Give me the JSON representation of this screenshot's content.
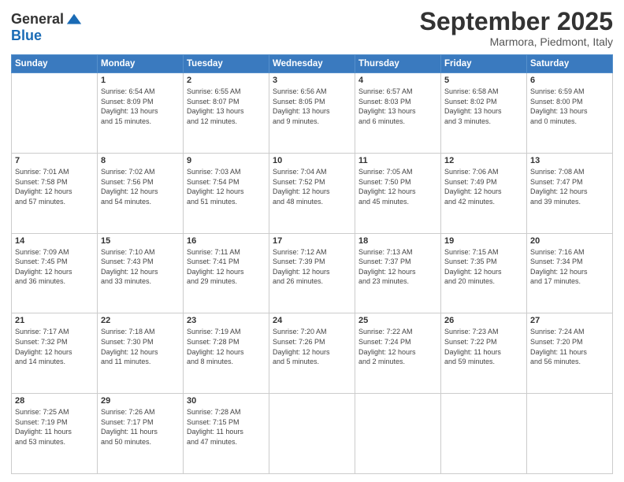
{
  "header": {
    "logo_line1": "General",
    "logo_line2": "Blue",
    "month": "September 2025",
    "location": "Marmora, Piedmont, Italy"
  },
  "weekdays": [
    "Sunday",
    "Monday",
    "Tuesday",
    "Wednesday",
    "Thursday",
    "Friday",
    "Saturday"
  ],
  "weeks": [
    [
      {
        "day": "",
        "text": ""
      },
      {
        "day": "1",
        "text": "Sunrise: 6:54 AM\nSunset: 8:09 PM\nDaylight: 13 hours\nand 15 minutes."
      },
      {
        "day": "2",
        "text": "Sunrise: 6:55 AM\nSunset: 8:07 PM\nDaylight: 13 hours\nand 12 minutes."
      },
      {
        "day": "3",
        "text": "Sunrise: 6:56 AM\nSunset: 8:05 PM\nDaylight: 13 hours\nand 9 minutes."
      },
      {
        "day": "4",
        "text": "Sunrise: 6:57 AM\nSunset: 8:03 PM\nDaylight: 13 hours\nand 6 minutes."
      },
      {
        "day": "5",
        "text": "Sunrise: 6:58 AM\nSunset: 8:02 PM\nDaylight: 13 hours\nand 3 minutes."
      },
      {
        "day": "6",
        "text": "Sunrise: 6:59 AM\nSunset: 8:00 PM\nDaylight: 13 hours\nand 0 minutes."
      }
    ],
    [
      {
        "day": "7",
        "text": "Sunrise: 7:01 AM\nSunset: 7:58 PM\nDaylight: 12 hours\nand 57 minutes."
      },
      {
        "day": "8",
        "text": "Sunrise: 7:02 AM\nSunset: 7:56 PM\nDaylight: 12 hours\nand 54 minutes."
      },
      {
        "day": "9",
        "text": "Sunrise: 7:03 AM\nSunset: 7:54 PM\nDaylight: 12 hours\nand 51 minutes."
      },
      {
        "day": "10",
        "text": "Sunrise: 7:04 AM\nSunset: 7:52 PM\nDaylight: 12 hours\nand 48 minutes."
      },
      {
        "day": "11",
        "text": "Sunrise: 7:05 AM\nSunset: 7:50 PM\nDaylight: 12 hours\nand 45 minutes."
      },
      {
        "day": "12",
        "text": "Sunrise: 7:06 AM\nSunset: 7:49 PM\nDaylight: 12 hours\nand 42 minutes."
      },
      {
        "day": "13",
        "text": "Sunrise: 7:08 AM\nSunset: 7:47 PM\nDaylight: 12 hours\nand 39 minutes."
      }
    ],
    [
      {
        "day": "14",
        "text": "Sunrise: 7:09 AM\nSunset: 7:45 PM\nDaylight: 12 hours\nand 36 minutes."
      },
      {
        "day": "15",
        "text": "Sunrise: 7:10 AM\nSunset: 7:43 PM\nDaylight: 12 hours\nand 33 minutes."
      },
      {
        "day": "16",
        "text": "Sunrise: 7:11 AM\nSunset: 7:41 PM\nDaylight: 12 hours\nand 29 minutes."
      },
      {
        "day": "17",
        "text": "Sunrise: 7:12 AM\nSunset: 7:39 PM\nDaylight: 12 hours\nand 26 minutes."
      },
      {
        "day": "18",
        "text": "Sunrise: 7:13 AM\nSunset: 7:37 PM\nDaylight: 12 hours\nand 23 minutes."
      },
      {
        "day": "19",
        "text": "Sunrise: 7:15 AM\nSunset: 7:35 PM\nDaylight: 12 hours\nand 20 minutes."
      },
      {
        "day": "20",
        "text": "Sunrise: 7:16 AM\nSunset: 7:34 PM\nDaylight: 12 hours\nand 17 minutes."
      }
    ],
    [
      {
        "day": "21",
        "text": "Sunrise: 7:17 AM\nSunset: 7:32 PM\nDaylight: 12 hours\nand 14 minutes."
      },
      {
        "day": "22",
        "text": "Sunrise: 7:18 AM\nSunset: 7:30 PM\nDaylight: 12 hours\nand 11 minutes."
      },
      {
        "day": "23",
        "text": "Sunrise: 7:19 AM\nSunset: 7:28 PM\nDaylight: 12 hours\nand 8 minutes."
      },
      {
        "day": "24",
        "text": "Sunrise: 7:20 AM\nSunset: 7:26 PM\nDaylight: 12 hours\nand 5 minutes."
      },
      {
        "day": "25",
        "text": "Sunrise: 7:22 AM\nSunset: 7:24 PM\nDaylight: 12 hours\nand 2 minutes."
      },
      {
        "day": "26",
        "text": "Sunrise: 7:23 AM\nSunset: 7:22 PM\nDaylight: 11 hours\nand 59 minutes."
      },
      {
        "day": "27",
        "text": "Sunrise: 7:24 AM\nSunset: 7:20 PM\nDaylight: 11 hours\nand 56 minutes."
      }
    ],
    [
      {
        "day": "28",
        "text": "Sunrise: 7:25 AM\nSunset: 7:19 PM\nDaylight: 11 hours\nand 53 minutes."
      },
      {
        "day": "29",
        "text": "Sunrise: 7:26 AM\nSunset: 7:17 PM\nDaylight: 11 hours\nand 50 minutes."
      },
      {
        "day": "30",
        "text": "Sunrise: 7:28 AM\nSunset: 7:15 PM\nDaylight: 11 hours\nand 47 minutes."
      },
      {
        "day": "",
        "text": ""
      },
      {
        "day": "",
        "text": ""
      },
      {
        "day": "",
        "text": ""
      },
      {
        "day": "",
        "text": ""
      }
    ]
  ]
}
